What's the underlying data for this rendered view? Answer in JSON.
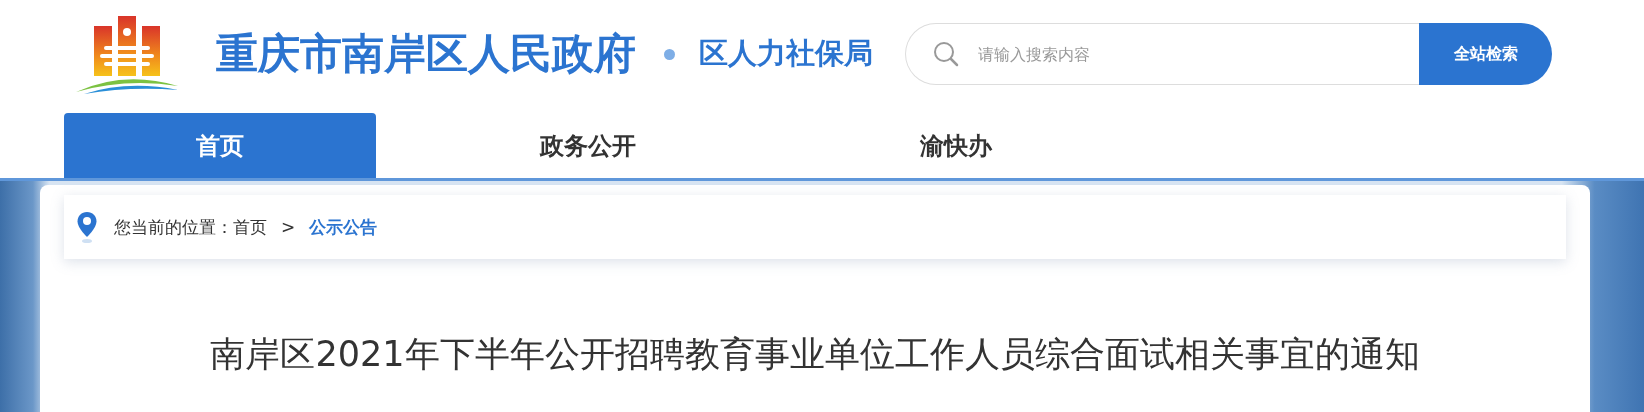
{
  "site": {
    "title": "重庆市南岸区人民政府",
    "department": "区人力社保局"
  },
  "search": {
    "placeholder": "请输入搜索内容",
    "button": "全站检索"
  },
  "nav": [
    {
      "label": "首页",
      "selected": true
    },
    {
      "label": "政务公开",
      "selected": false
    },
    {
      "label": "渝快办",
      "selected": false
    }
  ],
  "breadcrumb": {
    "prefix": "您当前的位置：",
    "separator": ">",
    "items": [
      {
        "label": "首页",
        "current": false
      },
      {
        "label": "公示公告",
        "current": true
      }
    ]
  },
  "article": {
    "title": "南岸区2021年下半年公开招聘教育事业单位工作人员综合面试相关事宜的通知"
  }
}
